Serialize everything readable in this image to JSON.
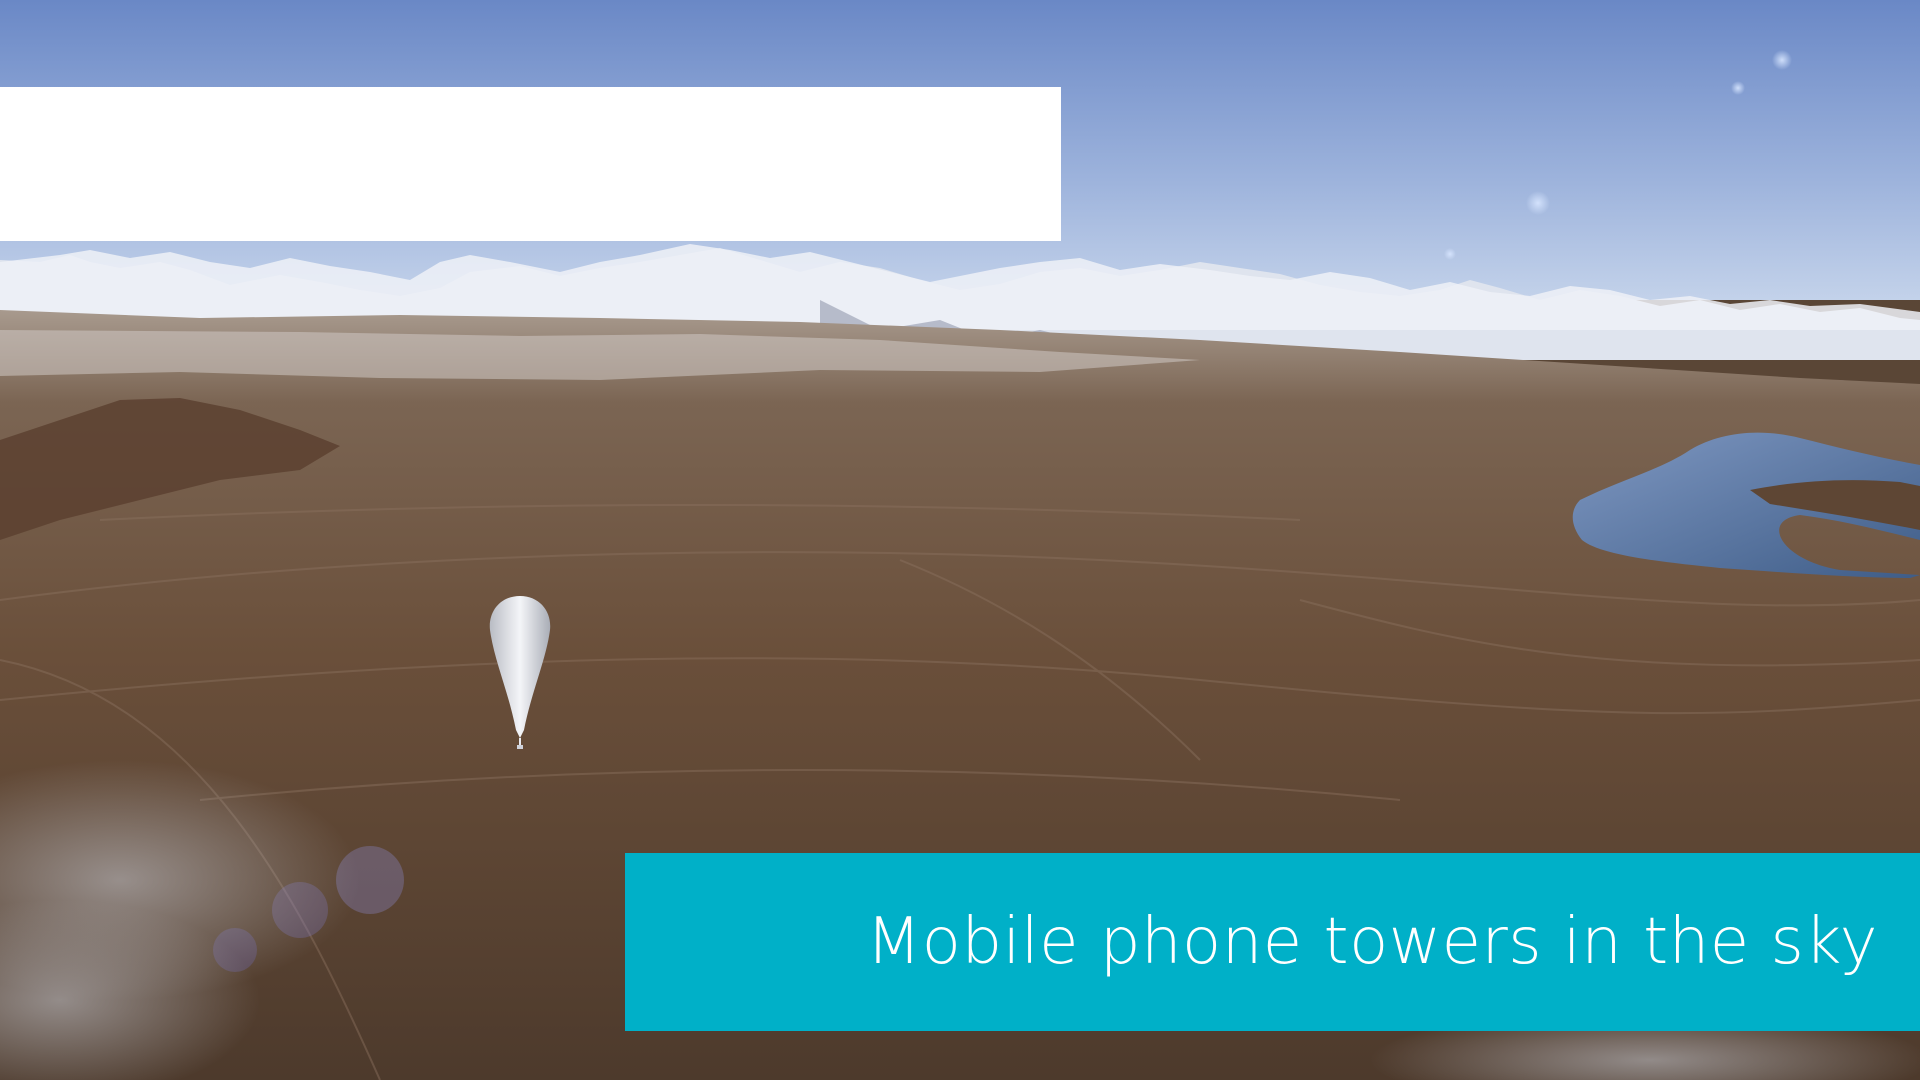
{
  "slide": {
    "caption": "Mobile phone towers in the sky"
  },
  "scene": {
    "description_icons": [
      "mountain-range",
      "lake",
      "balloon",
      "lens-flare",
      "cloud"
    ],
    "colors": {
      "sky_top": "#6f8fcf",
      "sky_bottom": "#b7c8e4",
      "snow": "#e8ecf4",
      "plain": "#6b5442",
      "lake": "#4b6a96",
      "caption_bg": "#00b0c8",
      "banner": "#ffffff"
    }
  }
}
